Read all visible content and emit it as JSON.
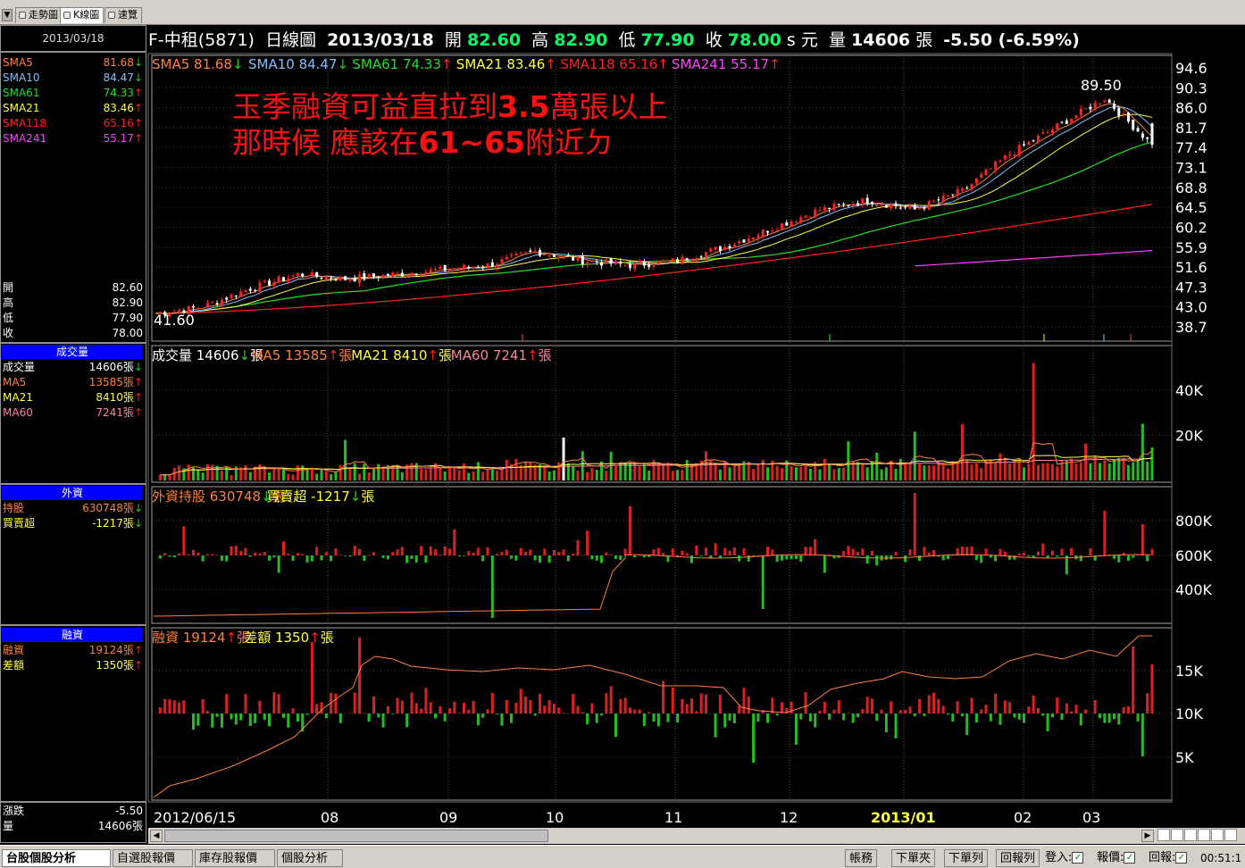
{
  "tabs": [
    {
      "label": "走勢圖",
      "active": false
    },
    {
      "label": "K線圖",
      "active": true
    },
    {
      "label": "速覽",
      "active": false
    }
  ],
  "menu_arrow": "▼",
  "left": {
    "date": "2013/03/18",
    "sma": [
      {
        "label": "SMA5",
        "value": "81.68",
        "dir": "down",
        "color": "#ff8040"
      },
      {
        "label": "SMA10",
        "value": "84.47",
        "dir": "down",
        "color": "#80c0ff"
      },
      {
        "label": "SMA61",
        "value": "74.33",
        "dir": "up",
        "color": "#20e020"
      },
      {
        "label": "SMA21",
        "value": "83.46",
        "dir": "up",
        "color": "#ffff40"
      },
      {
        "label": "SMA118",
        "value": "65.16",
        "dir": "up",
        "color": "#ff2020"
      },
      {
        "label": "SMA241",
        "value": "55.17",
        "dir": "up",
        "color": "#ff40ff"
      }
    ],
    "ohlc": [
      {
        "label": "開",
        "value": "82.60"
      },
      {
        "label": "高",
        "value": "82.90"
      },
      {
        "label": "低",
        "value": "77.90"
      },
      {
        "label": "收",
        "value": "78.00"
      }
    ],
    "volume": {
      "title": "成交量",
      "rows": [
        {
          "label": "成交量",
          "value": "14606張",
          "dir": "down",
          "color": "#ffffff"
        },
        {
          "label": "MA5",
          "value": "13585張",
          "dir": "up",
          "color": "#ff8040"
        },
        {
          "label": "MA21",
          "value": "8410張",
          "dir": "up",
          "color": "#ffff40"
        },
        {
          "label": "MA60",
          "value": "7241張",
          "dir": "up",
          "color": "#ff80a0"
        }
      ]
    },
    "foreign": {
      "title": "外資",
      "rows": [
        {
          "label": "持股",
          "value": "630748張",
          "dir": "down",
          "color": "#ff8040"
        },
        {
          "label": "買賣超",
          "value": "-1217張",
          "dir": "down",
          "color": "#ffff40"
        }
      ]
    },
    "margin": {
      "title": "融資",
      "rows": [
        {
          "label": "融資",
          "value": "19124張",
          "dir": "up",
          "color": "#ff8040"
        },
        {
          "label": "差額",
          "value": "1350張",
          "dir": "up",
          "color": "#ffff40"
        }
      ]
    },
    "bottom": [
      {
        "label": "漲跌",
        "value": "-5.50"
      },
      {
        "label": "量",
        "value": "14606張"
      }
    ]
  },
  "header": {
    "name": "F-中租(5871)",
    "period": "日線圖",
    "date": "2013/03/18",
    "open_label": "開",
    "open": "82.60",
    "high_label": "高",
    "high": "82.90",
    "low_label": "低",
    "low": "77.90",
    "close_label": "收",
    "close": "78.00",
    "close_suffix": "s 元",
    "vol_label": "量",
    "vol": "14606",
    "vol_unit": "張",
    "change": "-5.50 (-6.59%)"
  },
  "price_legend": [
    {
      "text": "SMA5 81.68",
      "dir": "down",
      "color": "#ff8040"
    },
    {
      "text": "SMA10 84.47",
      "dir": "down",
      "color": "#80c0ff"
    },
    {
      "text": "SMA61 74.33",
      "dir": "up",
      "color": "#20e020"
    },
    {
      "text": "SMA21 83.46",
      "dir": "up",
      "color": "#ffff40"
    },
    {
      "text": "SMA118 65.16",
      "dir": "up",
      "color": "#ff2020"
    },
    {
      "text": "SMA241 55.17",
      "dir": "up",
      "color": "#ff40ff"
    }
  ],
  "annotation": {
    "line1a": "玉季融資可益直拉到",
    "line1b": "3.5",
    "line1c": "萬張以上",
    "line2a": "那時候  應該在",
    "line2b": "61~65",
    "line2c": "附近ㄉ"
  },
  "price_axis": [
    "94.6",
    "90.3",
    "86.0",
    "81.7",
    "77.4",
    "73.1",
    "68.8",
    "64.5",
    "60.2",
    "55.9",
    "51.6",
    "47.3",
    "43.0",
    "38.7"
  ],
  "high_marker": "89.50",
  "low_marker": "41.60",
  "volume_legend": [
    {
      "text": "成交量 14606",
      "dir": "down",
      "unit": "張",
      "color": "#ffffff"
    },
    {
      "text": "MA5 13585",
      "dir": "up",
      "unit": "張",
      "color": "#ff8040"
    },
    {
      "text": "MA21 8410",
      "dir": "up",
      "unit": "張",
      "color": "#ffff40"
    },
    {
      "text": "MA60 7241",
      "dir": "up",
      "unit": "張",
      "color": "#ff80a0"
    }
  ],
  "volume_axis": [
    "40K",
    "20K"
  ],
  "foreign_legend": [
    {
      "text": "外資持股 630748",
      "dir": "down",
      "unit": "張",
      "color": "#ff8040"
    },
    {
      "text": "買賣超 -1217",
      "dir": "down",
      "unit": "張",
      "color": "#ffff40"
    }
  ],
  "foreign_axis": [
    "800K",
    "600K",
    "400K"
  ],
  "margin_legend": [
    {
      "text": "融資 19124",
      "dir": "up",
      "unit": "張",
      "color": "#ff8040"
    },
    {
      "text": "差額 1350",
      "dir": "up",
      "unit": "張",
      "color": "#ffff40"
    }
  ],
  "margin_axis": [
    "15K",
    "10K",
    "5K"
  ],
  "x_labels": [
    "2012/06/15",
    "08",
    "09",
    "10",
    "11",
    "12",
    "2013/01",
    "02",
    "03"
  ],
  "taskbar": {
    "buttons": [
      {
        "label": "台股個股分析",
        "active": true
      },
      {
        "label": "自選股報價",
        "active": false
      },
      {
        "label": "庫存股報價",
        "active": false
      },
      {
        "label": "個股分析",
        "active": false
      }
    ],
    "right_buttons": [
      "帳務",
      "下單夾",
      "下單列",
      "回報列"
    ],
    "checks": [
      "登入:",
      "報價:",
      "回報:"
    ],
    "time": "00:51:1"
  },
  "chart_data": [
    {
      "type": "candlestick",
      "title": "F-中租(5871) 日線圖",
      "x_range": [
        "2012/06/15",
        "2013/03/18"
      ],
      "ylim": [
        38.7,
        94.6
      ],
      "last": {
        "open": 82.6,
        "high": 82.9,
        "low": 77.9,
        "close": 78.0
      },
      "high": 89.5,
      "low": 41.6,
      "series": [
        {
          "name": "SMA5",
          "last": 81.68
        },
        {
          "name": "SMA10",
          "last": 84.47
        },
        {
          "name": "SMA21",
          "last": 83.46
        },
        {
          "name": "SMA61",
          "last": 74.33
        },
        {
          "name": "SMA118",
          "last": 65.16
        },
        {
          "name": "SMA241",
          "last": 55.17
        }
      ],
      "approx_close_path": [
        [
          0,
          41.6
        ],
        [
          10,
          43
        ],
        [
          20,
          47
        ],
        [
          30,
          50
        ],
        [
          40,
          49
        ],
        [
          50,
          50
        ],
        [
          60,
          51
        ],
        [
          70,
          52
        ],
        [
          80,
          55
        ],
        [
          90,
          53
        ],
        [
          100,
          52
        ],
        [
          110,
          53
        ],
        [
          120,
          56
        ],
        [
          130,
          60
        ],
        [
          140,
          64
        ],
        [
          150,
          66
        ],
        [
          160,
          64
        ],
        [
          170,
          68
        ],
        [
          180,
          76
        ],
        [
          190,
          82
        ],
        [
          200,
          88
        ],
        [
          210,
          78
        ]
      ]
    },
    {
      "type": "bar",
      "title": "成交量",
      "ylim": [
        0,
        52000
      ],
      "last": 14606,
      "peak": 52000
    },
    {
      "type": "bar",
      "title": "外資",
      "last_holding": 630748,
      "last_net": -1217
    },
    {
      "type": "bar",
      "title": "融資",
      "last_margin": 19124,
      "last_diff": 1350
    }
  ]
}
